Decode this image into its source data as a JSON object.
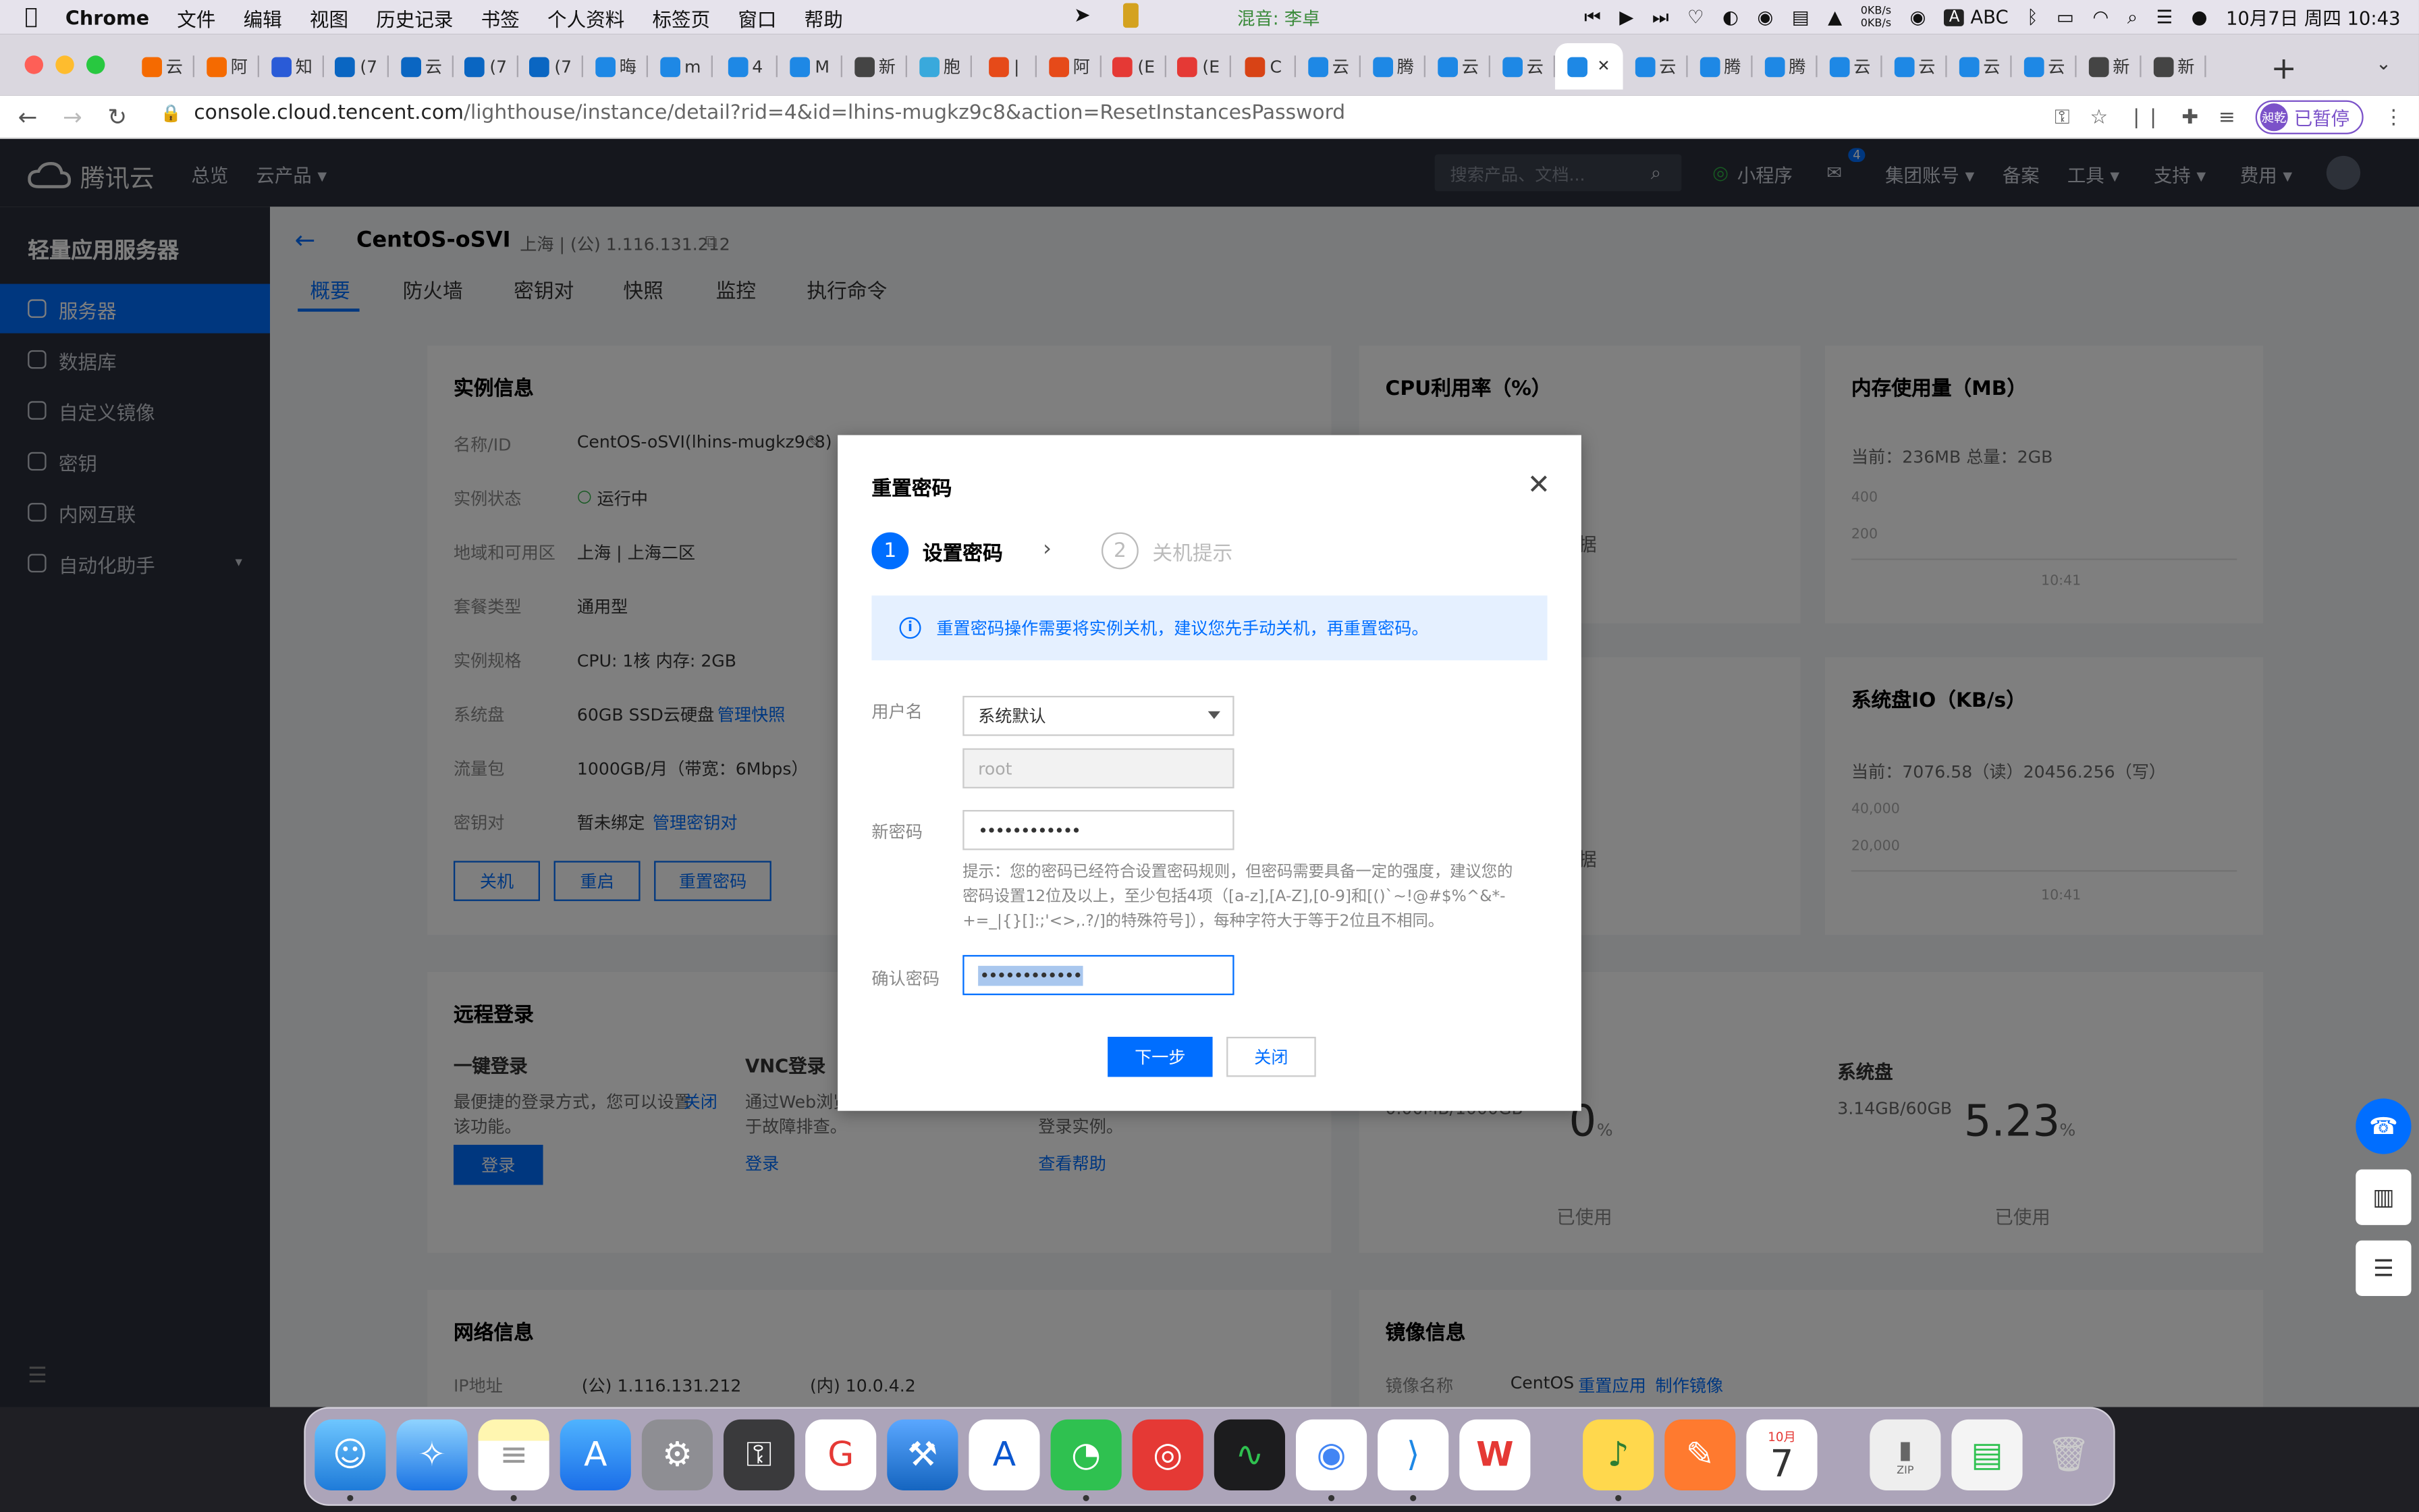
{
  "menubar": {
    "app": "Chrome",
    "items": [
      "文件",
      "编辑",
      "视图",
      "历史记录",
      "书签",
      "个人资料",
      "标签页",
      "窗口",
      "帮助"
    ],
    "music": "混音: 李卓",
    "net_up": "0KB/s",
    "net_down": "0KB/s",
    "input": "ABC",
    "datetime": "10月7日 周四  10:43"
  },
  "tabs": [
    {
      "label": "云",
      "color": "#f56a00"
    },
    {
      "label": "阿",
      "color": "#f56a00"
    },
    {
      "label": "知",
      "color": "#2a5bd7"
    },
    {
      "label": "(7",
      "color": "#0a66c2"
    },
    {
      "label": "云",
      "color": "#0a66c2"
    },
    {
      "label": "(7",
      "color": "#0a66c2"
    },
    {
      "label": "(7",
      "color": "#0a66c2"
    },
    {
      "label": "晦",
      "color": "#1e88e5"
    },
    {
      "label": "m",
      "color": "#1e88e5"
    },
    {
      "label": "4",
      "color": "#1e88e5"
    },
    {
      "label": "M",
      "color": "#1e88e5"
    },
    {
      "label": "新",
      "color": "#444"
    },
    {
      "label": "胞",
      "color": "#39a9dc"
    },
    {
      "label": "|",
      "color": "#e64a19"
    },
    {
      "label": "阿",
      "color": "#e64a19"
    },
    {
      "label": "(E",
      "color": "#e53935"
    },
    {
      "label": "(E",
      "color": "#e53935"
    },
    {
      "label": "C",
      "color": "#d84315"
    },
    {
      "label": "云",
      "color": "#1e88e5"
    },
    {
      "label": "腾",
      "color": "#1e88e5"
    },
    {
      "label": "云",
      "color": "#1e88e5"
    },
    {
      "label": "云",
      "color": "#1e88e5"
    },
    {
      "label": "",
      "color": "#1e88e5",
      "active": true
    },
    {
      "label": "云",
      "color": "#1e88e5"
    },
    {
      "label": "腾",
      "color": "#1e88e5"
    },
    {
      "label": "腾",
      "color": "#1e88e5"
    },
    {
      "label": "云",
      "color": "#1e88e5"
    },
    {
      "label": "云",
      "color": "#1e88e5"
    },
    {
      "label": "云",
      "color": "#1e88e5"
    },
    {
      "label": "云",
      "color": "#1e88e5"
    },
    {
      "label": "新",
      "color": "#444"
    },
    {
      "label": "新",
      "color": "#444"
    }
  ],
  "toolbar": {
    "url_host": "console.cloud.tencent.com",
    "url_path": "/lighthouse/instance/detail?rid=4&id=lhins-mugkz9c8&action=ResetInstancesPassword",
    "profile_badge": "昶乾",
    "profile_status": "已暂停"
  },
  "console": {
    "brand": "腾讯云",
    "nav": [
      "总览",
      "云产品 ▾"
    ],
    "search_placeholder": "搜索产品、文档...",
    "nav_right": [
      "小程序",
      "集团账号 ▾",
      "备案",
      "工具 ▾",
      "支持 ▾",
      "费用 ▾"
    ],
    "mail_badge": "4",
    "sidebar_title": "轻量应用服务器",
    "sidebar_items": [
      "服务器",
      "数据库",
      "自定义镜像",
      "密钥",
      "内网互联",
      "自动化助手"
    ],
    "instance_name": "CentOS-oSVI",
    "instance_region": "上海 | (公) 1.116.131.212",
    "tabs": [
      "概要",
      "防火墙",
      "密钥对",
      "快照",
      "监控",
      "执行命令"
    ],
    "info_title": "实例信息",
    "info_rows": [
      {
        "label": "名称/ID",
        "value": "CentOS-oSVI(lhins-mugkz9c8)"
      },
      {
        "label": "实例状态",
        "value": "运行中"
      },
      {
        "label": "地域和可用区",
        "value": "上海  |  上海二区"
      },
      {
        "label": "套餐类型",
        "value": "通用型"
      },
      {
        "label": "实例规格",
        "value": "CPU: 1核 内存: 2GB"
      },
      {
        "label": "系统盘",
        "value": "60GB SSD云硬盘",
        "link": "管理快照"
      },
      {
        "label": "流量包",
        "value": "1000GB/月（带宽：6Mbps）"
      },
      {
        "label": "密钥对",
        "value": "暂未绑定",
        "link": "管理密钥对"
      }
    ],
    "info_buttons": [
      "关机",
      "重启",
      "重置密码"
    ],
    "cpu_title": "CPU利用率（%）",
    "mem_title": "内存使用量（MB）",
    "mem_current": "当前：236MB 总量：2GB",
    "mem_ticks": [
      "400",
      "200"
    ],
    "mem_time": "10:41",
    "no_data": "数据",
    "disk_io_title": "系统盘IO（KB/s）",
    "disk_io_current": "当前：7076.58（读）20456.256（写）",
    "disk_io_ticks": [
      "40,000",
      "20,000"
    ],
    "disk_io_time": "10:41",
    "remote_title": "远程登录",
    "one_click_title": "一键登录",
    "one_click_desc": "最便捷的登录方式，您可以设置",
    "one_click_link": "关闭",
    "one_click_desc2": "该功能。",
    "login_button": "登录",
    "vnc_title": "VNC登录",
    "vnc_desc": "通过Web浏览",
    "vnc_desc2": "于故障排查。",
    "vnc_link": "登录",
    "other_desc": "登录实例。",
    "help_link": "查看帮助",
    "traffic_value": "0.00MB/1000GB",
    "traffic_pct": "0",
    "used_label": "已使用",
    "sysdisk_title": "系统盘",
    "sysdisk_value": "3.14GB/60GB",
    "sysdisk_pct": "5.23",
    "pct_unit": "%",
    "network_title": "网络信息",
    "ip_label": "IP地址",
    "ip_public": "(公) 1.116.131.212",
    "ip_private": "(内) 10.0.4.2",
    "image_title": "镜像信息",
    "image_label": "镜像名称",
    "image_name": "CentOS",
    "image_links": [
      "重置应用",
      "制作镜像"
    ]
  },
  "modal": {
    "title": "重置密码",
    "step1_num": "1",
    "step1": "设置密码",
    "step2_num": "2",
    "step2": "关机提示",
    "notice": "重置密码操作需要将实例关机，建议您先手动关机，再重置密码。",
    "username_label": "用户名",
    "username_select": "系统默认",
    "username_value": "root",
    "new_pw_label": "新密码",
    "new_pw_value": "••••••••••••",
    "hint": "提示：您的密码已经符合设置密码规则，但密码需要具备一定的强度，建议您的密码设置12位及以上，至少包括4项（[a-z],[A-Z],[0-9]和[()`~!@#$%^&*-+=_|{}[]:;'<>,.?/]的特殊符号]），每种字符大于等于2位且不相同。",
    "confirm_label": "确认密码",
    "confirm_value": "••••••••••••",
    "next_button": "下一步",
    "close_button": "关闭"
  },
  "dock": {
    "calendar_month": "10月",
    "calendar_day": "7",
    "zip_label": "ZIP"
  },
  "colors": {
    "accent": "#006eff",
    "nav_dark": "#2a2f3b",
    "sidebar": "#2b2f3a",
    "notice_bg": "#e5f0ff"
  }
}
